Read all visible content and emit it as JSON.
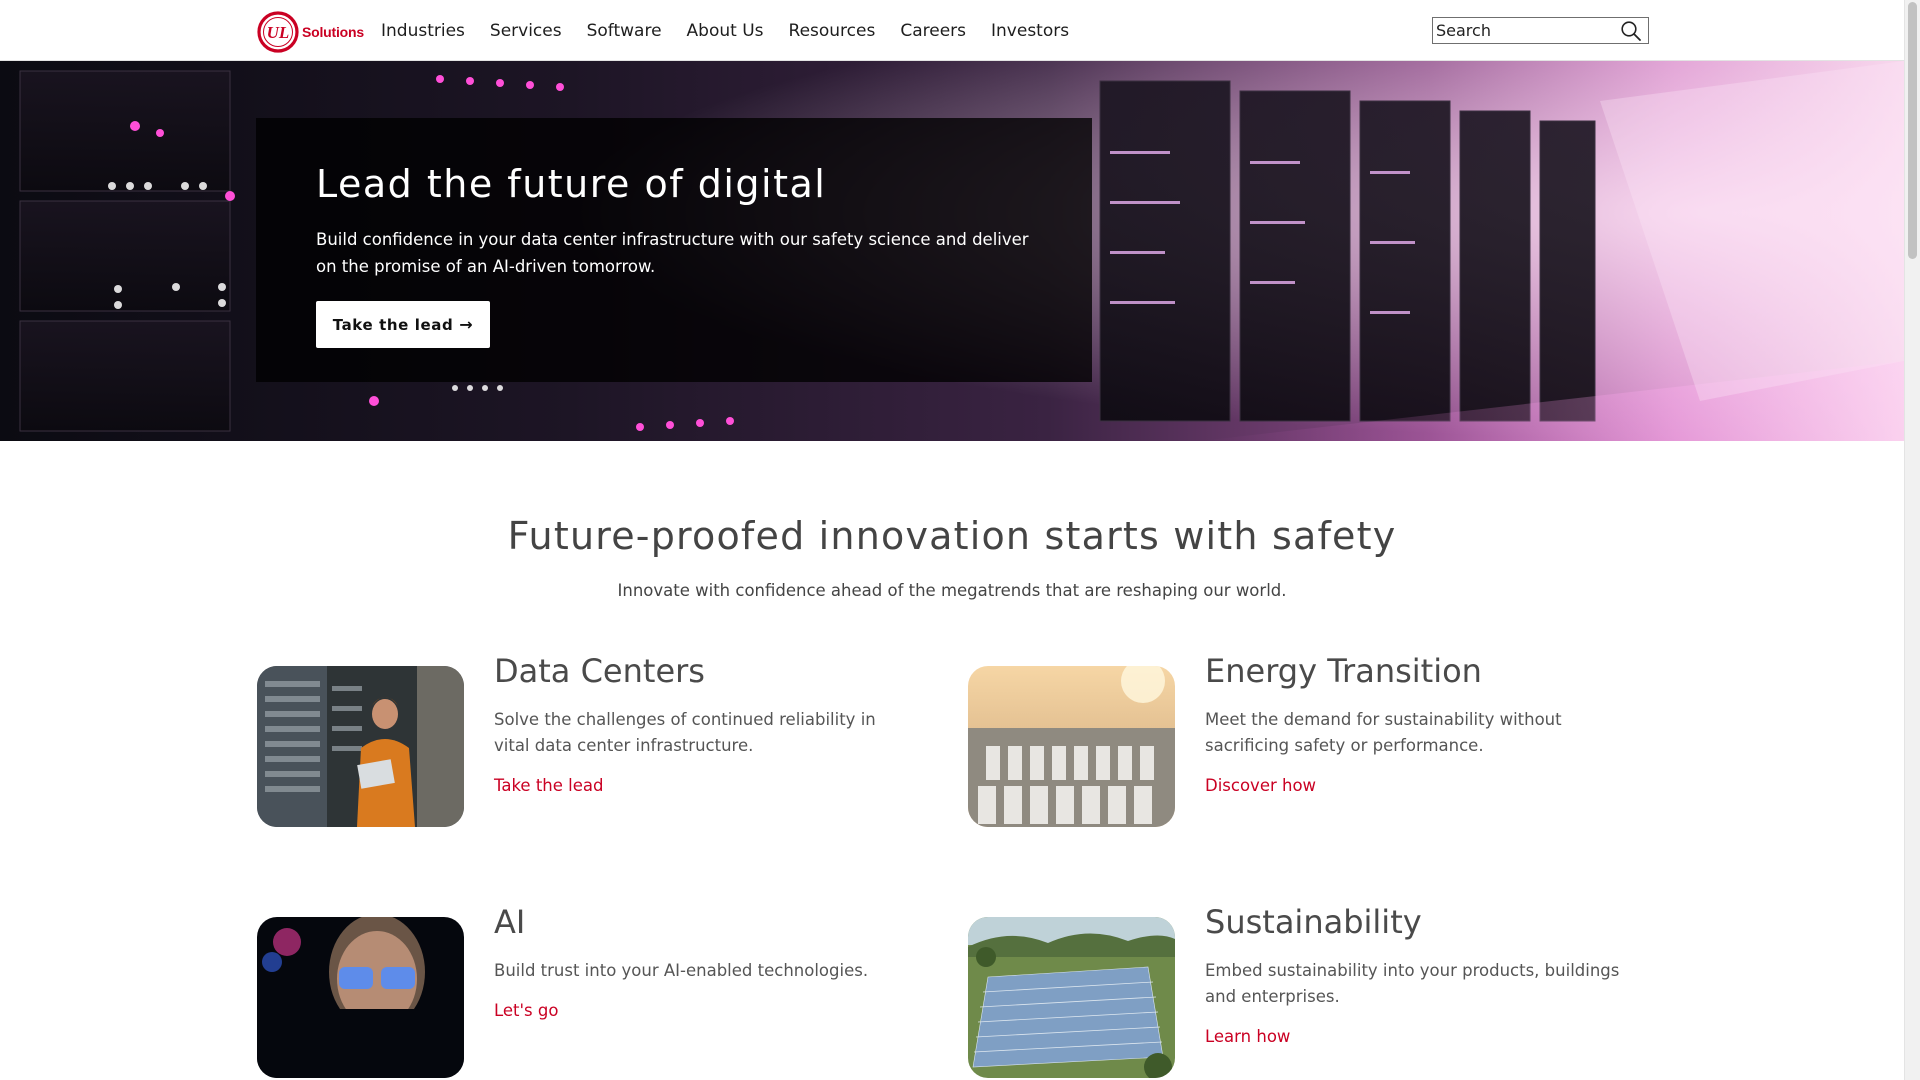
{
  "brand": {
    "logo_text": "Solutions",
    "logo_mark": "UL",
    "accent_color": "#ca0123"
  },
  "nav": {
    "items": [
      {
        "label": "Industries"
      },
      {
        "label": "Services"
      },
      {
        "label": "Software"
      },
      {
        "label": "About Us"
      },
      {
        "label": "Resources"
      },
      {
        "label": "Careers"
      },
      {
        "label": "Investors"
      }
    ]
  },
  "search": {
    "placeholder": "Search",
    "icon": "search-icon"
  },
  "hero": {
    "title": "Lead the future of digital",
    "text": "Build confidence in your data center infrastructure with our safety science and deliver on the promise of an AI-driven tomorrow.",
    "button_label": "Take the lead",
    "button_icon": "arrow-right-icon"
  },
  "section": {
    "title": "Future-proofed innovation starts with safety",
    "subtitle": "Innovate with confidence ahead of the megatrends that are reshaping our world."
  },
  "cards": [
    {
      "title": "Data Centers",
      "text": "Solve the challenges of continued reliability in vital data center infrastructure.",
      "link": "Take the lead",
      "image": "data-center-technician-photo"
    },
    {
      "title": "Energy Transition",
      "text": "Meet the demand for sustainability without sacrificing safety or performance.",
      "link": "Discover how",
      "image": "battery-storage-facility-photo"
    },
    {
      "title": "AI",
      "text": "Build trust into your AI-enabled technologies.",
      "link": "Let's go",
      "image": "person-with-glasses-photo"
    },
    {
      "title": "Sustainability",
      "text": "Embed sustainability into your products, buildings and enterprises.",
      "link": "Learn how",
      "image": "solar-farm-photo"
    }
  ]
}
